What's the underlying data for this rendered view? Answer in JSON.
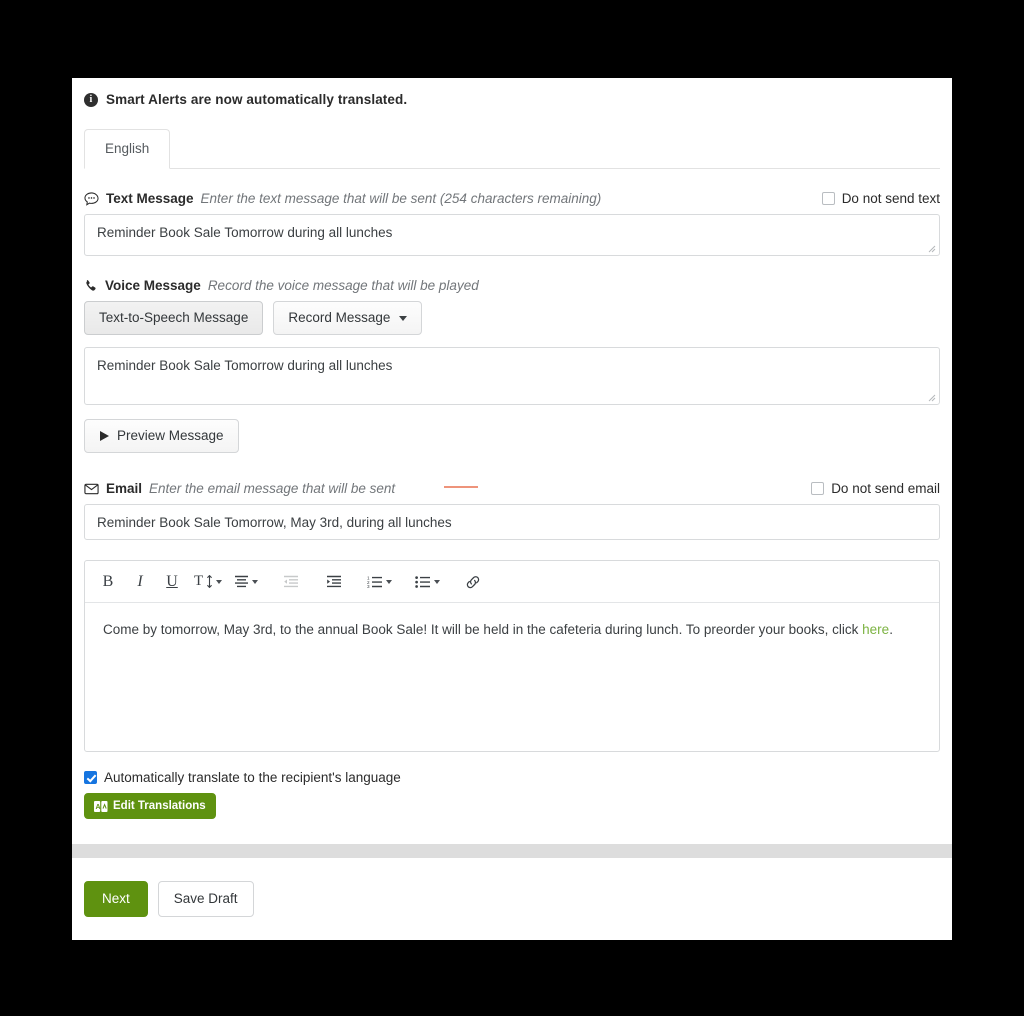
{
  "banner": {
    "icon": "info-circle-icon",
    "text": "Smart Alerts are now automatically translated."
  },
  "tabs": [
    {
      "label": "English",
      "active": true
    }
  ],
  "text_message": {
    "icon": "speech-bubble-icon",
    "title": "Text Message",
    "hint": "Enter the text message that will be sent (254 characters remaining)",
    "checkbox_label": "Do not send text",
    "checkbox_checked": false,
    "value": "Reminder Book Sale Tomorrow during all lunches",
    "placeholder": ""
  },
  "voice_message": {
    "icon": "phone-icon",
    "title": "Voice Message",
    "hint": "Record the voice message that will be played",
    "mode_buttons": [
      {
        "label": "Text-to-Speech Message",
        "active": true,
        "caret": false
      },
      {
        "label": "Record Message",
        "active": false,
        "caret": true
      }
    ],
    "value": "Reminder Book Sale Tomorrow during all lunches",
    "placeholder": "",
    "preview_label": "Preview Message",
    "preview_icon": "play-icon"
  },
  "email": {
    "icon": "envelope-icon",
    "title": "Email",
    "hint": "Enter the email message that will be sent",
    "checkbox_label": "Do not send email",
    "checkbox_checked": false,
    "subject_value": "Reminder Book Sale Tomorrow, May 3rd, during all lunches",
    "subject_placeholder": "",
    "toolbar": [
      {
        "name": "bold-icon",
        "label": "B",
        "caret": false,
        "disabled": false
      },
      {
        "name": "italic-icon",
        "label": "I",
        "caret": false,
        "disabled": false
      },
      {
        "name": "underline-icon",
        "label": "U",
        "caret": false,
        "disabled": false
      },
      {
        "name": "font-size-icon",
        "label": "Tt",
        "caret": true,
        "disabled": false
      },
      {
        "name": "align-icon",
        "label": "",
        "caret": true,
        "disabled": false
      },
      {
        "name": "outdent-icon",
        "label": "",
        "caret": false,
        "disabled": true
      },
      {
        "name": "indent-icon",
        "label": "",
        "caret": false,
        "disabled": false
      },
      {
        "name": "ordered-list-icon",
        "label": "",
        "caret": true,
        "disabled": false
      },
      {
        "name": "unordered-list-icon",
        "label": "",
        "caret": true,
        "disabled": false
      },
      {
        "name": "link-icon",
        "label": "",
        "caret": false,
        "disabled": false
      }
    ],
    "body_text": "Come by tomorrow, May 3rd, to the annual Book Sale! It will be held in the cafeteria during lunch. To preorder your books, click ",
    "body_link_text": "here",
    "body_after_link": "."
  },
  "translate": {
    "checkbox_label": "Automatically translate to the recipient's language",
    "checkbox_checked": true,
    "button_label": "Edit Translations",
    "button_icon": "translate-icon"
  },
  "footer": {
    "next_label": "Next",
    "draft_label": "Save Draft"
  },
  "colors": {
    "accent_green": "#5f9210",
    "link_green": "#7cb342",
    "checkbox_blue": "#1675e0",
    "border": "#d8dadc"
  }
}
